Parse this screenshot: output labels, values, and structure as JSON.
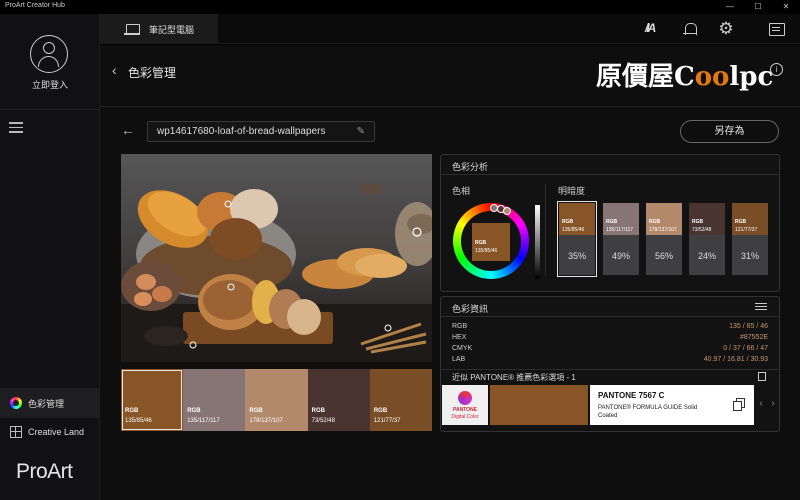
{
  "window": {
    "title": "ProArt Creator Hub",
    "controls": [
      "—",
      "☐",
      "✕"
    ]
  },
  "sidebar": {
    "login_label": "立即登入",
    "nav_items": [
      {
        "label": "色彩管理",
        "icon": "color-wheel-icon",
        "active": true
      },
      {
        "label": "Creative Land",
        "icon": "grid-icon",
        "active": false
      }
    ],
    "brand": "ProArt"
  },
  "topbar": {
    "tab_label": "筆記型電腦",
    "brand_mark": "/IA",
    "icons": [
      "bell-icon",
      "gear-icon",
      "message-icon"
    ]
  },
  "header": {
    "back": "‹",
    "title": "色彩管理",
    "watermark_prefix": "原價屋C",
    "watermark_oo": "oo",
    "watermark_suffix": "lpc"
  },
  "toolbar": {
    "back": "←",
    "file_name": "wp14617680-loaf-of-bread-wallpapers",
    "save_as_label": "另存為"
  },
  "swatches": [
    {
      "title": "RGB",
      "value": "135/85/46",
      "color": "#875526",
      "selected": true
    },
    {
      "title": "RGB",
      "value": "135/117/117",
      "color": "#877575",
      "selected": false
    },
    {
      "title": "RGB",
      "value": "178/137/107",
      "color": "#b2896b",
      "selected": false
    },
    {
      "title": "RGB",
      "value": "73/52/48",
      "color": "#493430",
      "selected": false
    },
    {
      "title": "RGB",
      "value": "121/77/37",
      "color": "#794d25",
      "selected": false
    }
  ],
  "analysis": {
    "title": "色彩分析",
    "hue_label": "色相",
    "brightness_label": "明暗度",
    "hue_swatch": {
      "title": "RGB",
      "value": "135/85/46",
      "color": "#875526"
    },
    "brightness_cards": [
      {
        "title": "RGB",
        "value": "135/85/46",
        "pct": "35%",
        "color": "#875526",
        "selected": true
      },
      {
        "title": "RGB",
        "value": "135/117/117",
        "pct": "49%",
        "color": "#877575",
        "selected": false
      },
      {
        "title": "RGB",
        "value": "178/137/107",
        "pct": "56%",
        "color": "#b2896b",
        "selected": false
      },
      {
        "title": "RGB",
        "value": "73/52/48",
        "pct": "24%",
        "color": "#493430",
        "selected": false
      },
      {
        "title": "RGB",
        "value": "121/77/37",
        "pct": "31%",
        "color": "#794d25",
        "selected": false
      }
    ]
  },
  "color_info": {
    "title": "色彩資訊",
    "rows": [
      {
        "label": "RGB",
        "value": "135 / 85 / 46"
      },
      {
        "label": "HEX",
        "value": "#87552E"
      },
      {
        "label": "CMYK",
        "value": "0 / 37 / 66 / 47"
      },
      {
        "label": "LAB",
        "value": "40.97 / 16.81 / 30.93"
      }
    ],
    "pantone_title": "近似 PANTONE® 推薦色彩選項 - 1",
    "pantone_logo_name": "PANTONE",
    "pantone_logo_sub": "Digital Color",
    "pantone_swatch_color": "#875526",
    "pantone_name": "PANTONE 7567 C",
    "pantone_guide": "PANTONE® FORMULA GUIDE Solid",
    "pantone_finish": "Coated",
    "pager_prev": "‹",
    "pager_next": "›"
  }
}
